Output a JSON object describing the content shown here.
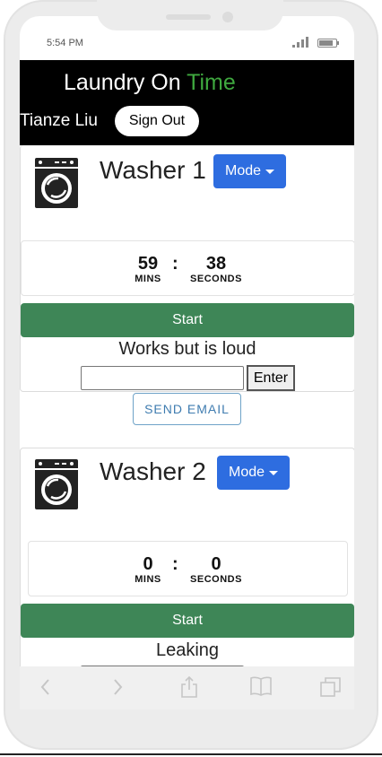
{
  "status_bar": {
    "time": "5:54 PM"
  },
  "header": {
    "brand_part1": "Laundry On",
    "brand_part2": "Time",
    "user_name": "Tianze Liu",
    "sign_out_label": "Sign Out"
  },
  "washers": [
    {
      "title": "Washer 1",
      "mode_label": "Mode",
      "minutes": "59",
      "seconds": "38",
      "mins_label": "MINS",
      "secs_label": "SECONDS",
      "start_label": "Start",
      "note": "Works but is loud",
      "note_input_value": "",
      "enter_label": "Enter"
    },
    {
      "title": "Washer 2",
      "mode_label": "Mode",
      "minutes": "0",
      "seconds": "0",
      "mins_label": "MINS",
      "secs_label": "SECONDS",
      "start_label": "Start",
      "note": "Leaking"
    }
  ],
  "send_email_label": "SEND EMAIL",
  "browser_bar": {
    "icons": [
      "back-icon",
      "forward-icon",
      "share-icon",
      "bookmarks-icon",
      "tabs-icon"
    ]
  },
  "colors": {
    "brand_accent": "#3fa83f",
    "mode_button": "#2e6de0",
    "start_button": "#3e8657",
    "send_email_text": "#3f7cb0"
  }
}
